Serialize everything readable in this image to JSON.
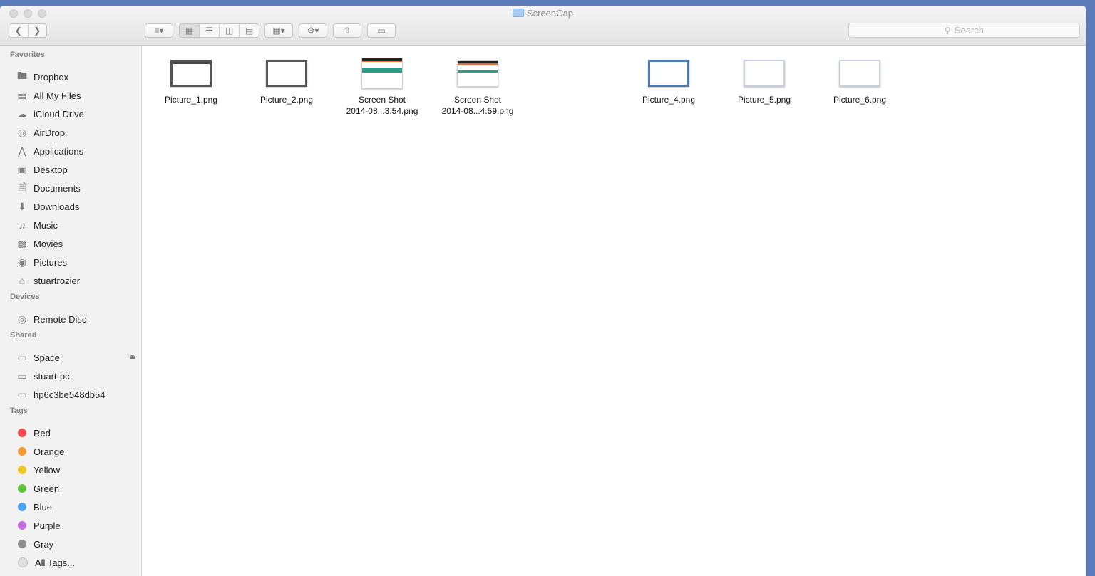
{
  "window": {
    "title": "ScreenCap"
  },
  "toolbar": {
    "search_placeholder": "Search"
  },
  "sidebar": {
    "favorites_label": "Favorites",
    "favorites": [
      {
        "label": "Dropbox",
        "icon": "folder-icon"
      },
      {
        "label": "All My Files",
        "icon": "all-files-icon"
      },
      {
        "label": "iCloud Drive",
        "icon": "cloud-icon"
      },
      {
        "label": "AirDrop",
        "icon": "airdrop-icon"
      },
      {
        "label": "Applications",
        "icon": "applications-icon"
      },
      {
        "label": "Desktop",
        "icon": "desktop-icon"
      },
      {
        "label": "Documents",
        "icon": "documents-icon"
      },
      {
        "label": "Downloads",
        "icon": "downloads-icon"
      },
      {
        "label": "Music",
        "icon": "music-icon"
      },
      {
        "label": "Movies",
        "icon": "movies-icon"
      },
      {
        "label": "Pictures",
        "icon": "camera-icon"
      },
      {
        "label": "stuartrozier",
        "icon": "home-icon"
      }
    ],
    "devices_label": "Devices",
    "devices": [
      {
        "label": "Remote Disc",
        "icon": "disc-icon"
      }
    ],
    "shared_label": "Shared",
    "shared": [
      {
        "label": "Space",
        "icon": "display-icon"
      },
      {
        "label": "stuart-pc",
        "icon": "display-icon"
      },
      {
        "label": "hp6c3be548db54",
        "icon": "display-icon"
      }
    ],
    "tags_label": "Tags",
    "tags": [
      {
        "label": "Red",
        "color": "#f24c4c"
      },
      {
        "label": "Orange",
        "color": "#f29a36"
      },
      {
        "label": "Yellow",
        "color": "#ecc829"
      },
      {
        "label": "Green",
        "color": "#62c43d"
      },
      {
        "label": "Blue",
        "color": "#4aa3f0"
      },
      {
        "label": "Purple",
        "color": "#c46fe0"
      },
      {
        "label": "Gray",
        "color": "#8e8e8e"
      },
      {
        "label": "All Tags...",
        "color": "#e0e0e0"
      }
    ]
  },
  "files": [
    {
      "line1": "Picture_1.png",
      "line2": ""
    },
    {
      "line1": "Picture_2.png",
      "line2": ""
    },
    {
      "line1": "Screen Shot",
      "line2": "2014-08...3.54.png"
    },
    {
      "line1": "Screen Shot",
      "line2": "2014-08...4.59.png"
    },
    {
      "line1": "Picture_4.png",
      "line2": ""
    },
    {
      "line1": "Picture_5.png",
      "line2": ""
    },
    {
      "line1": "Picture_6.png",
      "line2": ""
    }
  ]
}
